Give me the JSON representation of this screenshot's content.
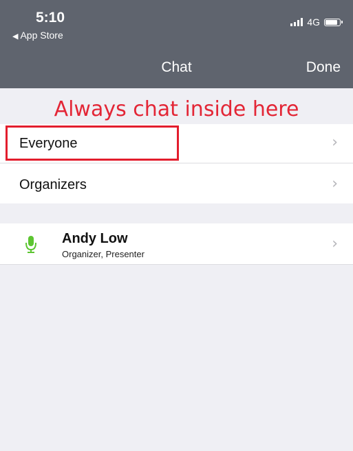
{
  "status_bar": {
    "time": "5:10",
    "back_app": "App Store",
    "network": "4G"
  },
  "nav": {
    "title": "Chat",
    "done": "Done"
  },
  "annotation": {
    "text": "Always chat inside here",
    "color": "#e32636"
  },
  "groups": [
    {
      "label": "Everyone"
    },
    {
      "label": "Organizers"
    }
  ],
  "participants": [
    {
      "name": "Andy Low",
      "role": "Organizer, Presenter",
      "mic_color": "#5cc531"
    }
  ],
  "colors": {
    "header": "#5f646e",
    "background": "#efeff4",
    "highlight": "#e31d2d"
  }
}
